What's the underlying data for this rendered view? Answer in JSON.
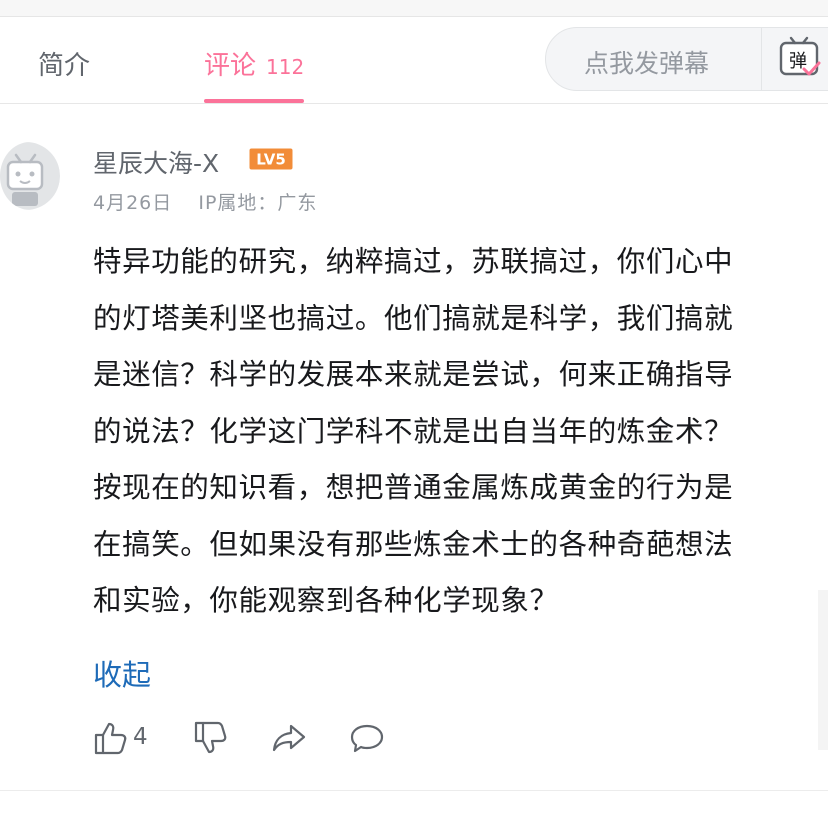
{
  "tabs": {
    "intro_label": "简介",
    "comments_label": "评论",
    "comments_count": "112"
  },
  "danmaku": {
    "placeholder": "点我发弹幕",
    "toggle_glyph": "弹"
  },
  "comment": {
    "username": "星辰大海-X",
    "level_badge": "LV5",
    "date": "4月26日",
    "ip_location": "IP属地：广东",
    "lines": [
      "特异功能的研究，纳粹搞过，苏联搞过，你们心中",
      "的灯塔美利坚也搞过。他们搞就是科学，我们搞就",
      "是迷信？科学的发展本来就是尝试，何来正确指导",
      "的说法？化学这门学科不就是出自当年的炼金术？",
      "按现在的知识看，想把普通金属炼成黄金的行为是",
      "在搞笑。但如果没有那些炼金术士的各种奇葩想法",
      "和实验，你能观察到各种化学现象？"
    ],
    "collapse_label": "收起",
    "like_count": "4"
  },
  "icons": {
    "like": "thumbs-up-icon",
    "dislike": "thumbs-down-icon",
    "share": "share-icon",
    "reply": "reply-bubble-icon",
    "danmaku": "danmaku-toggle-icon"
  },
  "colors": {
    "accent_pink": "#fb7299",
    "link_blue": "#1e6bb8",
    "level_orange": "#f28c38"
  }
}
